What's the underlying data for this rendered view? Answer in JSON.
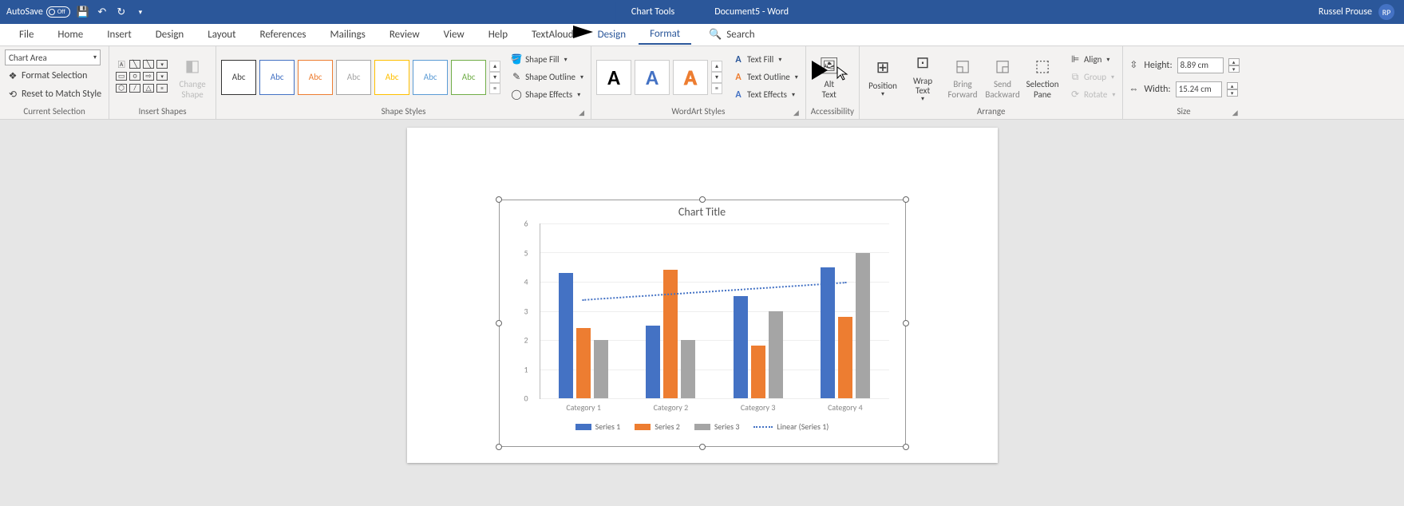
{
  "title_bar": {
    "autosave_label": "AutoSave",
    "autosave_state": "Off",
    "context_tab": "Chart Tools",
    "doc_title": "Document5  -  Word",
    "user_name": "Russel Prouse",
    "user_initials": "RP"
  },
  "tabs": {
    "file": "File",
    "home": "Home",
    "insert": "Insert",
    "design_p": "Design",
    "layout": "Layout",
    "references": "References",
    "mailings": "Mailings",
    "review": "Review",
    "view": "View",
    "help": "Help",
    "textaloud": "TextAloud",
    "design_ct": "Design",
    "format": "Format",
    "search": "Search"
  },
  "ribbon": {
    "current_selection": {
      "selector_value": "Chart Area",
      "format_selection": "Format Selection",
      "reset_match": "Reset to Match Style",
      "label": "Current Selection"
    },
    "insert_shapes": {
      "change_shape": "Change\nShape",
      "label": "Insert Shapes"
    },
    "shape_styles": {
      "abc": "Abc",
      "shape_fill": "Shape Fill",
      "shape_outline": "Shape Outline",
      "shape_effects": "Shape Effects",
      "label": "Shape Styles"
    },
    "wordart_styles": {
      "text_fill": "Text Fill",
      "text_outline": "Text Outline",
      "text_effects": "Text Effects",
      "label": "WordArt Styles"
    },
    "accessibility": {
      "alt_text": "Alt\nText",
      "label": "Accessibility"
    },
    "arrange": {
      "position": "Position",
      "wrap_text": "Wrap\nText",
      "bring_forward": "Bring\nForward",
      "send_backward": "Send\nBackward",
      "selection_pane": "Selection\nPane",
      "align": "Align",
      "group": "Group",
      "rotate": "Rotate",
      "label": "Arrange"
    },
    "size": {
      "height_label": "Height:",
      "height_val": "8.89 cm",
      "width_label": "Width:",
      "width_val": "15.24 cm",
      "label": "Size"
    }
  },
  "chart_data": {
    "type": "bar",
    "title": "Chart Title",
    "categories": [
      "Category 1",
      "Category 2",
      "Category 3",
      "Category 4"
    ],
    "series": [
      {
        "name": "Series 1",
        "values": [
          4.3,
          2.5,
          3.5,
          4.5
        ],
        "color": "#4472c4"
      },
      {
        "name": "Series 2",
        "values": [
          2.4,
          4.4,
          1.8,
          2.8
        ],
        "color": "#ed7d31"
      },
      {
        "name": "Series 3",
        "values": [
          2.0,
          2.0,
          3.0,
          5.0
        ],
        "color": "#a5a5a5"
      }
    ],
    "trendline": {
      "name": "Linear (Series 1)",
      "values": [
        3.4,
        3.55,
        3.85,
        4.0
      ],
      "style": "dotted",
      "color": "#4472c4"
    },
    "ylim": [
      0,
      6
    ],
    "yticks": [
      0,
      1,
      2,
      3,
      4,
      5,
      6
    ]
  }
}
